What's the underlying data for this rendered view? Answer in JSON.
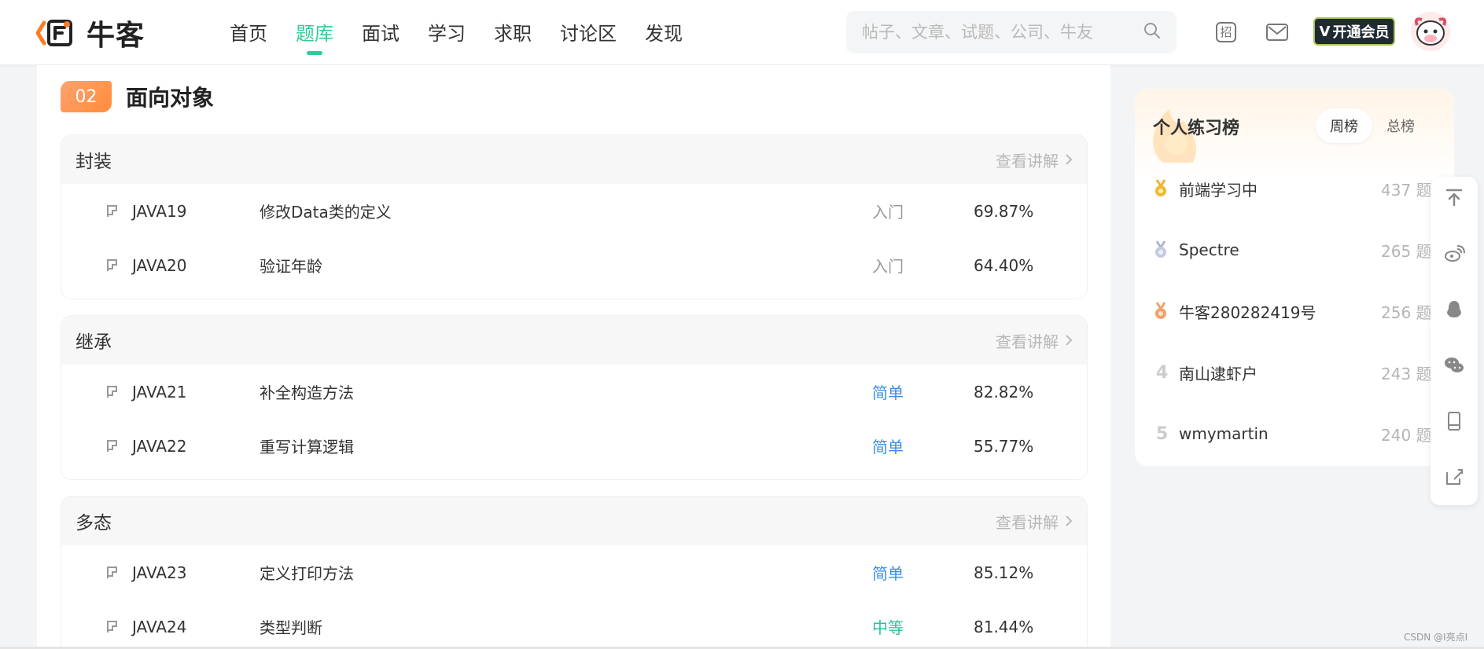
{
  "brand": {
    "name": "牛客"
  },
  "nav": {
    "items": [
      "首页",
      "题库",
      "面试",
      "学习",
      "求职",
      "讨论区",
      "发现"
    ]
  },
  "search": {
    "placeholder": "帖子、文章、试题、公司、牛友"
  },
  "header": {
    "vip_label": "开通会员",
    "vip_badge": "V",
    "icons": [
      "recruit-icon",
      "mail-icon"
    ]
  },
  "section": {
    "number": "02",
    "title": "面向对象"
  },
  "groups": [
    {
      "title": "封装",
      "link": "查看讲解",
      "rows": [
        {
          "code": "JAVA19",
          "title": "修改Data类的定义",
          "level": "入门",
          "rate": "69.87%"
        },
        {
          "code": "JAVA20",
          "title": "验证年龄",
          "level": "入门",
          "rate": "64.40%"
        }
      ]
    },
    {
      "title": "继承",
      "link": "查看讲解",
      "rows": [
        {
          "code": "JAVA21",
          "title": "补全构造方法",
          "level": "简单",
          "rate": "82.82%"
        },
        {
          "code": "JAVA22",
          "title": "重写计算逻辑",
          "level": "简单",
          "rate": "55.77%"
        }
      ]
    },
    {
      "title": "多态",
      "link": "查看讲解",
      "rows": [
        {
          "code": "JAVA23",
          "title": "定义打印方法",
          "level": "简单",
          "rate": "85.12%"
        },
        {
          "code": "JAVA24",
          "title": "类型判断",
          "level": "中等",
          "rate": "81.44%"
        }
      ]
    }
  ],
  "levels": {
    "入门": "#999999",
    "简单": "#3a8ee6",
    "中等": "#2cc09b"
  },
  "ranking": {
    "title": "个人练习榜",
    "tabs": [
      "周榜",
      "总榜"
    ],
    "items": [
      {
        "rank": "1",
        "name": "前端学习中",
        "score": "437 题"
      },
      {
        "rank": "2",
        "name": "Spectre",
        "score": "265 题"
      },
      {
        "rank": "3",
        "name": "牛客280282419号",
        "score": "256 题"
      },
      {
        "rank": "4",
        "name": "南山逮虾户",
        "score": "243 题"
      },
      {
        "rank": "5",
        "name": "wmymartin",
        "score": "240 题"
      }
    ]
  },
  "float": {
    "icons": [
      "back-to-top-icon",
      "weibo-icon",
      "qq-icon",
      "wechat-icon",
      "phone-icon",
      "edit-icon"
    ]
  },
  "watermark": "CSDN @I亮点I"
}
